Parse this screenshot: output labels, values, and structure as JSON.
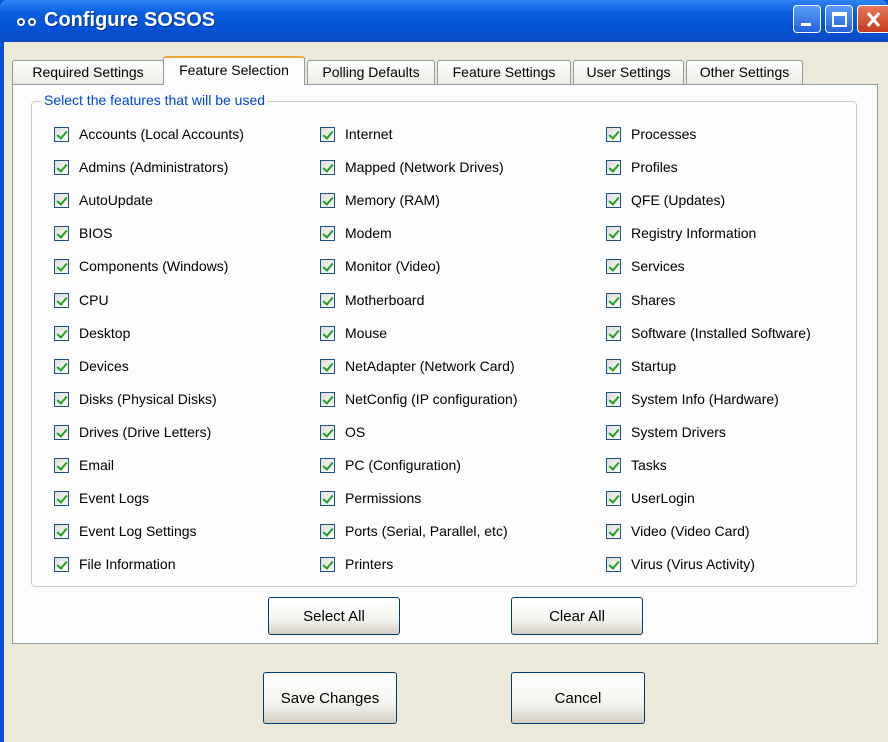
{
  "window": {
    "title": "Configure SOSOS"
  },
  "tabs": [
    {
      "label": "Required Settings",
      "active": false
    },
    {
      "label": "Feature Selection",
      "active": true
    },
    {
      "label": "Polling Defaults",
      "active": false
    },
    {
      "label": "Feature Settings",
      "active": false
    },
    {
      "label": "User Settings",
      "active": false
    },
    {
      "label": "Other Settings",
      "active": false
    }
  ],
  "features": {
    "group_label": "Select the features that will be used",
    "columns": [
      [
        {
          "label": "Accounts (Local Accounts)",
          "checked": true
        },
        {
          "label": "Admins (Administrators)",
          "checked": true
        },
        {
          "label": "AutoUpdate",
          "checked": true
        },
        {
          "label": "BIOS",
          "checked": true
        },
        {
          "label": "Components (Windows)",
          "checked": true
        },
        {
          "label": "CPU",
          "checked": true
        },
        {
          "label": "Desktop",
          "checked": true
        },
        {
          "label": "Devices",
          "checked": true
        },
        {
          "label": "Disks (Physical Disks)",
          "checked": true
        },
        {
          "label": "Drives (Drive Letters)",
          "checked": true
        },
        {
          "label": "Email",
          "checked": true
        },
        {
          "label": "Event Logs",
          "checked": true
        },
        {
          "label": "Event Log Settings",
          "checked": true
        },
        {
          "label": "File Information",
          "checked": true
        }
      ],
      [
        {
          "label": "Internet",
          "checked": true
        },
        {
          "label": "Mapped (Network Drives)",
          "checked": true
        },
        {
          "label": "Memory (RAM)",
          "checked": true
        },
        {
          "label": "Modem",
          "checked": true
        },
        {
          "label": "Monitor (Video)",
          "checked": true
        },
        {
          "label": "Motherboard",
          "checked": true
        },
        {
          "label": "Mouse",
          "checked": true
        },
        {
          "label": "NetAdapter (Network Card)",
          "checked": true
        },
        {
          "label": "NetConfig (IP configuration)",
          "checked": true
        },
        {
          "label": "OS",
          "checked": true
        },
        {
          "label": "PC (Configuration)",
          "checked": true
        },
        {
          "label": "Permissions",
          "checked": true
        },
        {
          "label": "Ports (Serial, Parallel, etc)",
          "checked": true
        },
        {
          "label": "Printers",
          "checked": true
        }
      ],
      [
        {
          "label": "Processes",
          "checked": true
        },
        {
          "label": "Profiles",
          "checked": true
        },
        {
          "label": "QFE (Updates)",
          "checked": true
        },
        {
          "label": "Registry Information",
          "checked": true
        },
        {
          "label": "Services",
          "checked": true
        },
        {
          "label": "Shares",
          "checked": true
        },
        {
          "label": "Software (Installed Software)",
          "checked": true
        },
        {
          "label": "Startup",
          "checked": true
        },
        {
          "label": "System Info (Hardware)",
          "checked": true
        },
        {
          "label": "System Drivers",
          "checked": true
        },
        {
          "label": "Tasks",
          "checked": true
        },
        {
          "label": "UserLogin",
          "checked": true
        },
        {
          "label": "Video (Video Card)",
          "checked": true
        },
        {
          "label": "Virus (Virus Activity)",
          "checked": true
        }
      ]
    ]
  },
  "buttons": {
    "select_all": "Select All",
    "clear_all": "Clear All",
    "save": "Save Changes",
    "cancel": "Cancel"
  },
  "colors": {
    "titlebar": "#0a5ee0",
    "dialog_face": "#ece9d8",
    "tab_highlight": "#f2a93b",
    "group_label": "#0046d5",
    "check_mark": "#21a121"
  }
}
